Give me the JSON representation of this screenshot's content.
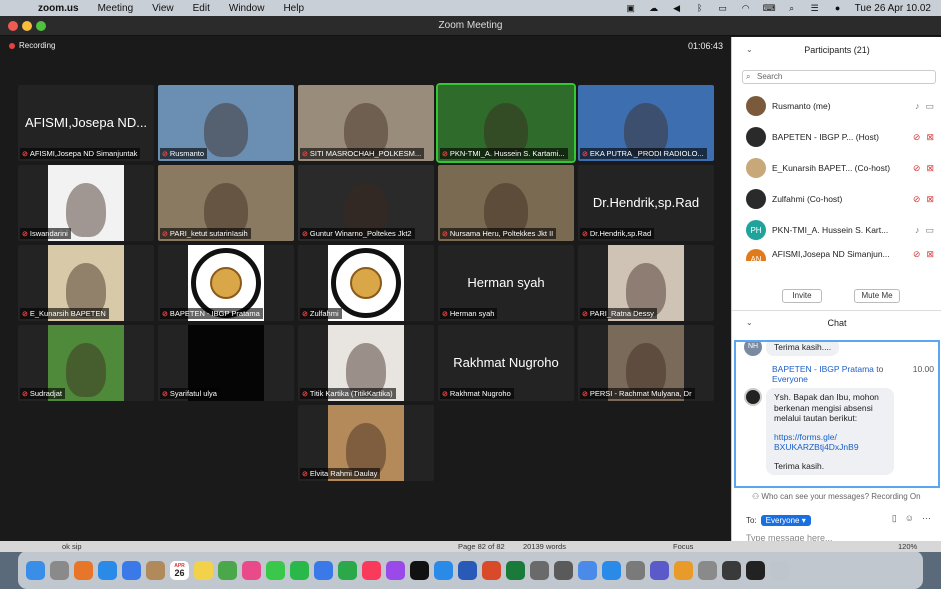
{
  "menubar": {
    "app": "zoom.us",
    "items": [
      "Meeting",
      "View",
      "Edit",
      "Window",
      "Help"
    ],
    "clock": "Tue 26 Apr  10.02"
  },
  "window": {
    "title": "Zoom Meeting"
  },
  "meeting": {
    "recording": "Recording",
    "timer": "01:06:43",
    "tiles": [
      {
        "label": "AFISMI,Josepa ND Simanjuntak",
        "bigname": "AFISMI,Josepa ND...",
        "kind": "name"
      },
      {
        "label": "Rusmanto",
        "kind": "video",
        "bg": "#6a8fb3"
      },
      {
        "label": "SITI MASROCHAH_POLKESM...",
        "kind": "video",
        "bg": "#9a8c7a"
      },
      {
        "label": "PKN-TMI_A. Hussein S. Kartami...",
        "kind": "video",
        "bg": "#2f6b2a",
        "speaking": true
      },
      {
        "label": "EKA PUTRA _PRODI RADIOLO...",
        "kind": "video",
        "bg": "#3d6fb0"
      },
      {
        "label": "Iswandarini",
        "kind": "video",
        "bg": "#f2f2f2"
      },
      {
        "label": "PARI_ketut sutarinIasih",
        "kind": "video",
        "bg": "#8a7a62"
      },
      {
        "label": "Guntur Winarno_Poltekes Jkt2",
        "kind": "video",
        "bg": "#2a2a2a"
      },
      {
        "label": "Nursama Heru, Poltekkes Jkt II",
        "kind": "video",
        "bg": "#7a6a52"
      },
      {
        "label": "Dr.Hendrik,sp.Rad",
        "bigname": "Dr.Hendrik,sp.Rad",
        "kind": "name"
      },
      {
        "label": "E_Kunarsih BAPETEN",
        "kind": "video",
        "bg": "#d8c9a8"
      },
      {
        "label": "BAPETEN - IBGP Pratama",
        "kind": "seal"
      },
      {
        "label": "Zulfahmi",
        "kind": "seal"
      },
      {
        "label": "Herman syah",
        "bigname": "Herman syah",
        "kind": "name"
      },
      {
        "label": "PARI_Ratna Dessy",
        "kind": "video",
        "bg": "#cfc3b6"
      },
      {
        "label": "Sudradjat",
        "kind": "video",
        "bg": "#4f8a3a"
      },
      {
        "label": "Syarifatul ulya",
        "kind": "video",
        "bg": "#050505"
      },
      {
        "label": "Titik Kartika (TitikKartika)",
        "kind": "video",
        "bg": "#e8e4e0"
      },
      {
        "label": "Rakhmat Nugroho",
        "bigname": "Rakhmat Nugroho",
        "kind": "name"
      },
      {
        "label": "PERSI - Rachmat Mulyana, Dr",
        "kind": "video",
        "bg": "#7a6a5a"
      },
      {
        "label": "Elvita Rahmi Daulay",
        "kind": "video",
        "bg": "#b58a5a"
      }
    ]
  },
  "participants": {
    "title": "Participants (21)",
    "search_placeholder": "Search",
    "list": [
      {
        "name": "Rusmanto (me)",
        "avatar": "",
        "color": "#7a5a3a",
        "mic": "on",
        "cam": "on"
      },
      {
        "name": "BAPETEN - IBGP P... (Host)",
        "avatar": "",
        "color": "#2a2a2a",
        "mic": "off",
        "cam": "off"
      },
      {
        "name": "E_Kunarsih BAPET... (Co-host)",
        "avatar": "",
        "color": "#c8a878",
        "mic": "off",
        "cam": "off"
      },
      {
        "name": "Zulfahmi (Co-host)",
        "avatar": "",
        "color": "#2a2a2a",
        "mic": "off",
        "cam": "off"
      },
      {
        "name": "PKN-TMI_A. Hussein S. Kart...",
        "avatar": "PH",
        "color": "#1fa39a",
        "mic": "on",
        "cam": "on"
      },
      {
        "name": "AFISMI,Josepa ND Simanjun...",
        "avatar": "AN",
        "color": "#e07a1a",
        "mic": "off",
        "cam": "off"
      }
    ],
    "invite": "Invite",
    "mute_me": "Mute Me"
  },
  "chat": {
    "title": "Chat",
    "prev_avatar": "NH",
    "prev_msg": "Terima kasih....",
    "sender": "BAPETEN - IBGP Pratama",
    "to_word": "to",
    "recipient": "Everyone",
    "time": "10.00",
    "msg_line": "Ysh. Bapak dan Ibu, mohon berkenan mengisi absensi melalui tautan berikut:",
    "link1": "https://forms.gle/",
    "link2": "BXUKARZBtj4DxJnB9",
    "thanks": "Terima kasih.",
    "seen": "Who can see your messages? Recording On",
    "to_label": "To:",
    "to_value": "Everyone",
    "placeholder": "Type message here..."
  },
  "docstrip": {
    "left": "ok sip",
    "page": "Page 82 of 82",
    "words": "20139 words",
    "focus": "Focus",
    "zoom": "120%"
  },
  "dock": {
    "calendar_month": "APR",
    "calendar_day": "26",
    "apps": [
      "finder-icon",
      "launchpad-icon",
      "firefox-icon",
      "safari-icon",
      "mail-icon",
      "contacts-icon",
      "calendar-icon",
      "notes-icon",
      "maps-icon",
      "photos-icon",
      "messages-icon",
      "facetime-icon",
      "keynote-icon",
      "numbers-icon",
      "music-icon",
      "podcasts-icon",
      "tv-icon",
      "appstore-icon",
      "word-icon",
      "powerpoint-icon",
      "excel-icon",
      "vpn-icon",
      "calculator-icon",
      "preview-icon",
      "zoom-icon",
      "screenshot-icon",
      "teams-icon",
      "home-icon",
      "settings-icon",
      "activity-icon",
      "terminal-icon",
      "trash-icon"
    ]
  }
}
